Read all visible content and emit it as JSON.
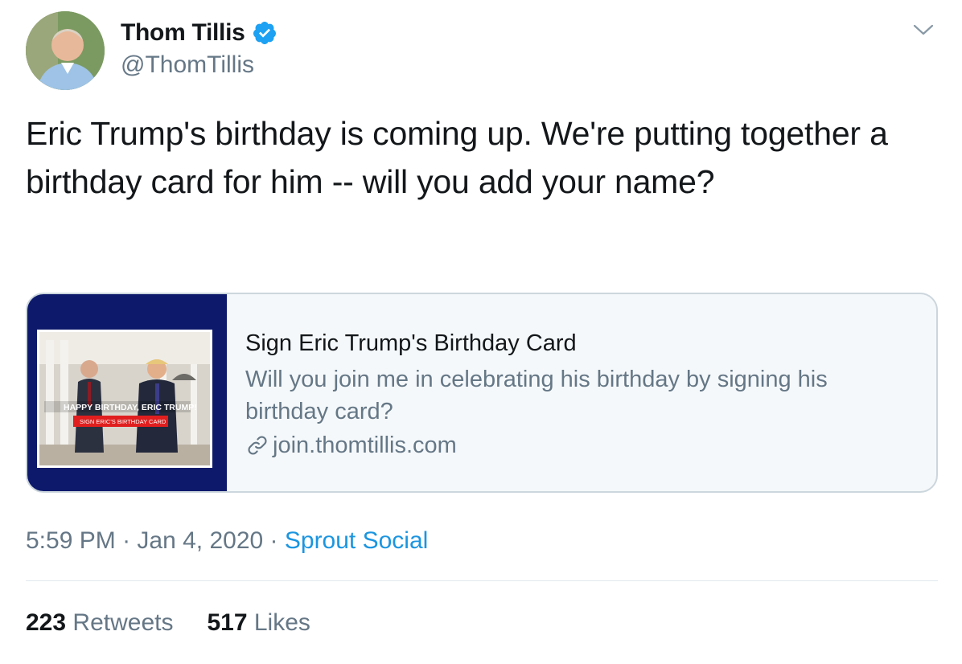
{
  "author": {
    "display_name": "Thom Tillis",
    "handle": "@ThomTillis",
    "verified_icon": "verified-badge-icon"
  },
  "tweet": {
    "text": "Eric Trump's birthday is coming up. We're putting together a birthday card for him -- will you add your name?"
  },
  "card": {
    "title": "Sign Eric Trump's Birthday Card",
    "description": "Will you join me in celebrating his birthday by signing his birthday card?",
    "url": "join.thomtillis.com",
    "thumb_banner": "HAPPY BIRTHDAY, ERIC TRUMP!",
    "thumb_button": "SIGN ERIC'S BIRTHDAY CARD"
  },
  "meta": {
    "time": "5:59 PM",
    "sep1": " · ",
    "date": "Jan 4, 2020",
    "sep2": " · ",
    "source": "Sprout Social"
  },
  "stats": {
    "retweets_count": "223",
    "retweets_label": "Retweets",
    "likes_count": "517",
    "likes_label": "Likes"
  },
  "colors": {
    "link_blue": "#1b95e0",
    "secondary_text": "#657786",
    "card_thumb_bg": "#0d1a6b"
  }
}
